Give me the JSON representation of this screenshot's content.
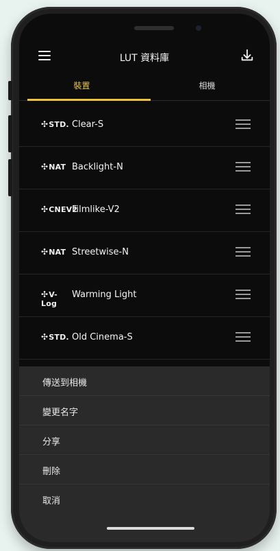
{
  "window": {
    "title": "LUT 資料庫"
  },
  "tabs": [
    {
      "label": "裝置"
    },
    {
      "label": "相機"
    }
  ],
  "luts": [
    {
      "badge": "STD.",
      "name": "Clear-S"
    },
    {
      "badge": "NAT",
      "name": "Backlight-N"
    },
    {
      "badge": "CNEV2",
      "name": "Filmlike-V2"
    },
    {
      "badge": "NAT",
      "name": "Streetwise-N"
    },
    {
      "badge": "V-Log",
      "name": "Warming Light"
    },
    {
      "badge": "STD.",
      "name": "Old Cinema-S"
    }
  ],
  "actions": [
    {
      "label": "傳送到相機"
    },
    {
      "label": "變更名字"
    },
    {
      "label": "分享"
    },
    {
      "label": "刪除"
    },
    {
      "label": "取消"
    }
  ],
  "icons": {
    "menu": "hamburger-menu-icon",
    "download": "download-icon",
    "reorder": "drag-handle-icon"
  },
  "colors": {
    "accent": "#f0c33a",
    "background": "#0c0c0c",
    "sheet": "#2a2a2a"
  }
}
